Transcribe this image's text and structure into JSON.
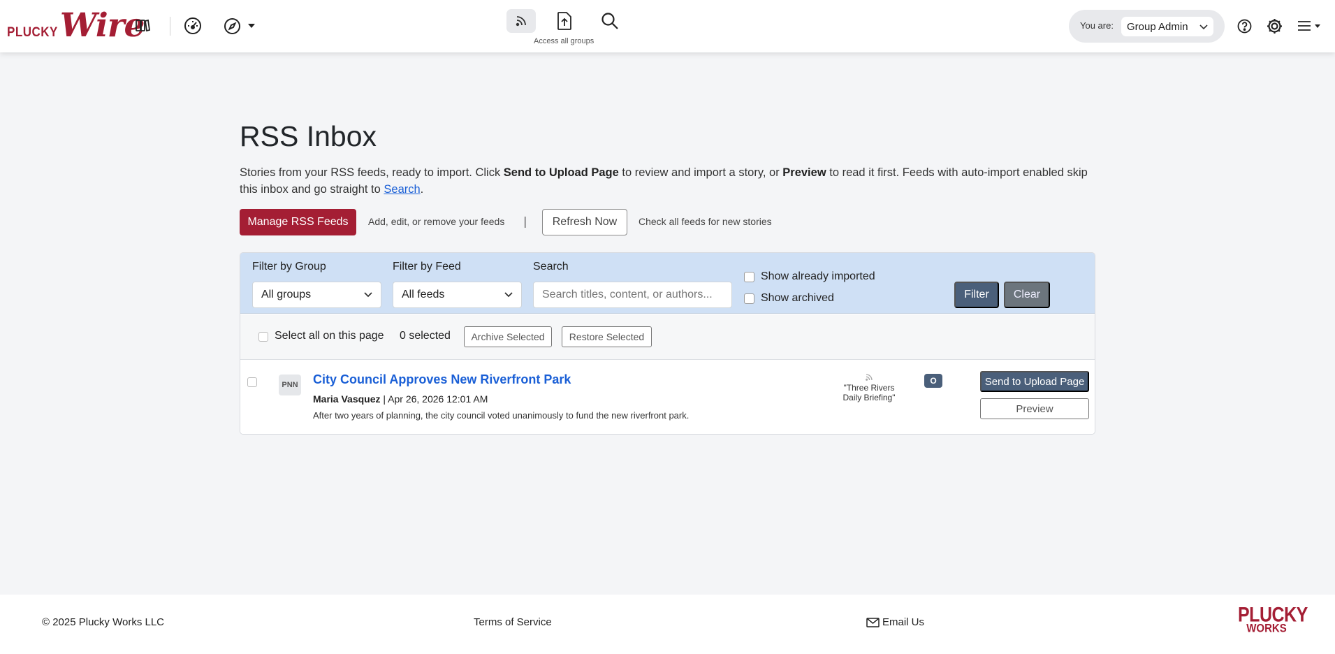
{
  "brand": {
    "plucky": "PLUCKY",
    "wire": "Wire"
  },
  "header": {
    "access_label": "Access all groups",
    "you_are_label": "You are:",
    "role_value": "Group Admin"
  },
  "page": {
    "title": "RSS Inbox",
    "intro_1": "Stories from your RSS feeds, ready to import. Click ",
    "intro_bold_1": "Send to Upload Page",
    "intro_2": " to review and import a story, or ",
    "intro_bold_2": "Preview",
    "intro_3": " to read it first. Feeds with auto-import enabled skip this inbox and go straight to ",
    "intro_link": "Search",
    "intro_4": "."
  },
  "actions": {
    "manage_label": "Manage RSS Feeds",
    "manage_hint": "Add, edit, or remove your feeds",
    "separator": "|",
    "refresh_label": "Refresh Now",
    "refresh_hint": "Check all feeds for new stories"
  },
  "filters": {
    "group_label": "Filter by Group",
    "group_value": "All groups",
    "feed_label": "Filter by Feed",
    "feed_value": "All feeds",
    "search_label": "Search",
    "search_placeholder": "Search titles, content, or authors...",
    "show_imported": "Show already imported",
    "show_archived": "Show archived",
    "filter_button": "Filter",
    "clear_button": "Clear"
  },
  "selection": {
    "select_all": "Select all on this page",
    "count": "0 selected",
    "archive_button": "Archive Selected",
    "restore_button": "Restore Selected"
  },
  "stories": [
    {
      "source_badge": "PNN",
      "title": "City Council Approves New Riverfront Park",
      "author": "Maria Vasquez",
      "meta_sep": " | ",
      "date": "Apr 26, 2026 12:01 AM",
      "summary": "After two years of planning, the city council voted unanimously to fund the new riverfront park.",
      "feed_line1": "\"Three Rivers",
      "feed_line2": "Daily Briefing\"",
      "badge": "O",
      "send_button": "Send to Upload Page",
      "preview_button": "Preview"
    }
  ],
  "footer": {
    "copyright": "© 2025 Plucky Works LLC",
    "terms": "Terms of Service",
    "email": "Email Us",
    "logo_line1": "PLUCKY",
    "logo_line2": "WORKS"
  },
  "colors": {
    "brand_red": "#a41e34",
    "slate_button": "#4a5f7a",
    "filter_bar": "#cfe0f5",
    "link_blue": "#1a5fd6"
  }
}
